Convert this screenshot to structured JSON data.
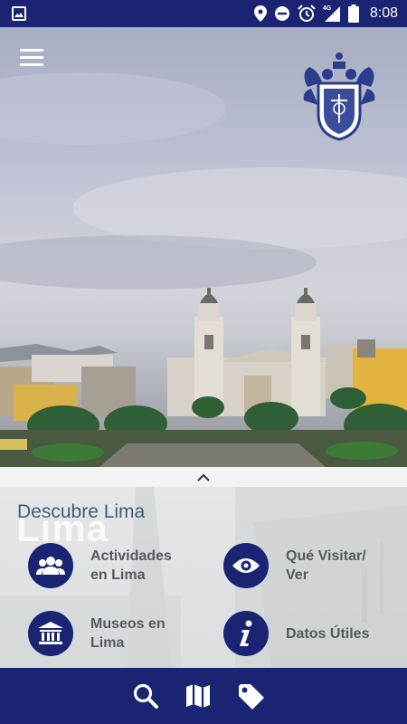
{
  "status_bar": {
    "time": "8:08",
    "network": "4G",
    "icons": [
      "image-icon",
      "location-icon",
      "do-not-disturb-icon",
      "alarm-icon",
      "signal-icon",
      "battery-icon"
    ]
  },
  "hero": {
    "icons": [
      "menu-icon",
      "coat-of-arms-logo"
    ]
  },
  "panel": {
    "title": "Descubre Lima",
    "subtitle": "Lima",
    "items": [
      {
        "line1": "Actividades",
        "line2": "en Lima",
        "icon": "group-icon"
      },
      {
        "line1": "Qué Visitar/",
        "line2": "Ver",
        "icon": "eye-icon"
      },
      {
        "line1": "Museos en",
        "line2": "Lima",
        "icon": "museum-icon"
      },
      {
        "line1": "Datos Útiles",
        "line2": "",
        "icon": "info-icon"
      }
    ]
  },
  "bottom_nav": {
    "icons": [
      "search-icon",
      "map-icon",
      "tag-icon"
    ]
  },
  "colors": {
    "primary": "#1b2473",
    "panel_title": "#3b5f7a",
    "label": "#555a60"
  }
}
